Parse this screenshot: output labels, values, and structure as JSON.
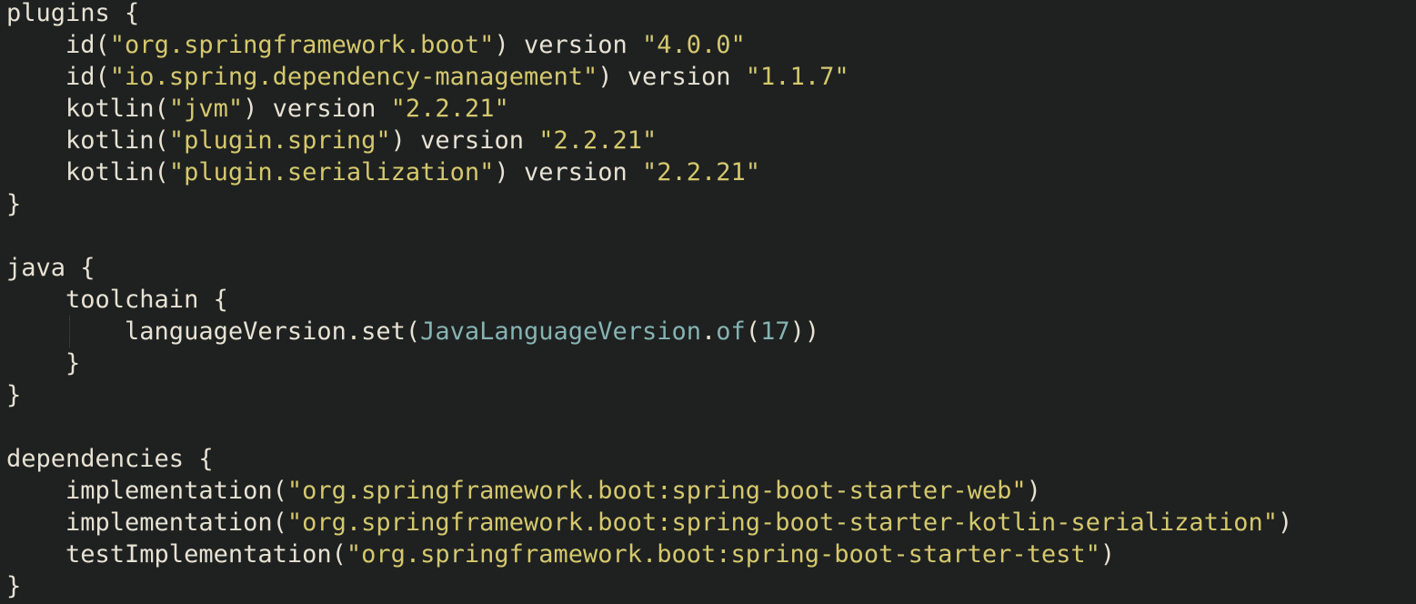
{
  "editor": {
    "lines": [
      {
        "tokens": [
          {
            "t": "plugins {",
            "c": "plain"
          }
        ]
      },
      {
        "tokens": [
          {
            "t": "    id(",
            "c": "plain"
          },
          {
            "t": "\"org.springframework.boot\"",
            "c": "string"
          },
          {
            "t": ") version ",
            "c": "plain"
          },
          {
            "t": "\"4.0.0\"",
            "c": "string"
          }
        ]
      },
      {
        "tokens": [
          {
            "t": "    id(",
            "c": "plain"
          },
          {
            "t": "\"io.spring.dependency-management\"",
            "c": "string"
          },
          {
            "t": ") version ",
            "c": "plain"
          },
          {
            "t": "\"1.1.7\"",
            "c": "string"
          }
        ]
      },
      {
        "tokens": [
          {
            "t": "    kotlin(",
            "c": "plain"
          },
          {
            "t": "\"jvm\"",
            "c": "string"
          },
          {
            "t": ") version ",
            "c": "plain"
          },
          {
            "t": "\"2.2.21\"",
            "c": "string"
          }
        ]
      },
      {
        "tokens": [
          {
            "t": "    kotlin(",
            "c": "plain"
          },
          {
            "t": "\"plugin.spring\"",
            "c": "string"
          },
          {
            "t": ") version ",
            "c": "plain"
          },
          {
            "t": "\"2.2.21\"",
            "c": "string"
          }
        ]
      },
      {
        "tokens": [
          {
            "t": "    kotlin(",
            "c": "plain"
          },
          {
            "t": "\"plugin.serialization\"",
            "c": "string"
          },
          {
            "t": ") version ",
            "c": "plain"
          },
          {
            "t": "\"2.2.21\"",
            "c": "string"
          }
        ]
      },
      {
        "tokens": [
          {
            "t": "}",
            "c": "plain"
          }
        ]
      },
      {
        "tokens": []
      },
      {
        "tokens": [
          {
            "t": "java {",
            "c": "plain"
          }
        ]
      },
      {
        "tokens": [
          {
            "t": "    toolchain {",
            "c": "plain"
          }
        ]
      },
      {
        "tokens": [
          {
            "t": "        languageVersion.set(",
            "c": "plain"
          },
          {
            "t": "JavaLanguageVersion",
            "c": "type"
          },
          {
            "t": ".",
            "c": "plain"
          },
          {
            "t": "of",
            "c": "type"
          },
          {
            "t": "(",
            "c": "plain"
          },
          {
            "t": "17",
            "c": "number"
          },
          {
            "t": "))",
            "c": "plain"
          }
        ],
        "guide": true
      },
      {
        "tokens": [
          {
            "t": "    }",
            "c": "plain"
          }
        ]
      },
      {
        "tokens": [
          {
            "t": "}",
            "c": "plain"
          }
        ]
      },
      {
        "tokens": []
      },
      {
        "tokens": [
          {
            "t": "dependencies {",
            "c": "plain"
          }
        ]
      },
      {
        "tokens": [
          {
            "t": "    implementation(",
            "c": "plain"
          },
          {
            "t": "\"org.springframework.boot:spring-boot-starter-web\"",
            "c": "string"
          },
          {
            "t": ")",
            "c": "plain"
          }
        ]
      },
      {
        "tokens": [
          {
            "t": "    implementation(",
            "c": "plain"
          },
          {
            "t": "\"org.springframework.boot:spring-boot-starter-kotlin-serialization\"",
            "c": "string"
          },
          {
            "t": ")",
            "c": "plain"
          }
        ]
      },
      {
        "tokens": [
          {
            "t": "    testImplementation(",
            "c": "plain"
          },
          {
            "t": "\"org.springframework.boot:spring-boot-starter-test\"",
            "c": "string"
          },
          {
            "t": ")",
            "c": "plain"
          }
        ]
      },
      {
        "tokens": [
          {
            "t": "}",
            "c": "plain"
          }
        ]
      }
    ]
  }
}
